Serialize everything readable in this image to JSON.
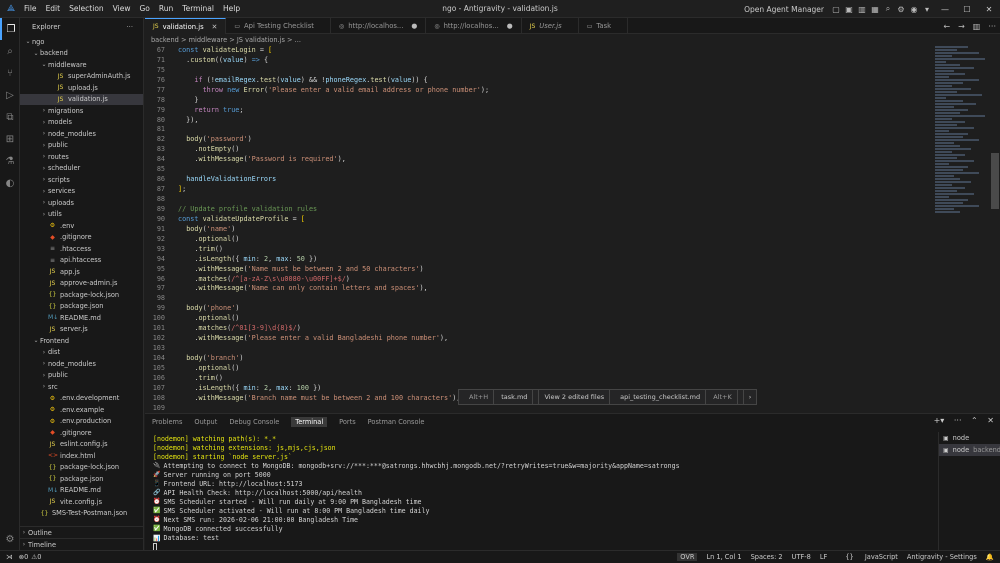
{
  "titlebar": {
    "menu": [
      "File",
      "Edit",
      "Selection",
      "View",
      "Go",
      "Run",
      "Terminal",
      "Help"
    ],
    "title": "ngo - Antigravity - validation.js",
    "agent_manager": "Open Agent Manager"
  },
  "sidebar": {
    "title": "Explorer",
    "outline": "Outline",
    "timeline": "Timeline"
  },
  "tree": [
    {
      "label": "ngo",
      "depth": 0,
      "type": "folder",
      "open": true
    },
    {
      "label": "backend",
      "depth": 1,
      "type": "folder",
      "open": true
    },
    {
      "label": "middleware",
      "depth": 2,
      "type": "folder",
      "open": true
    },
    {
      "label": "superAdminAuth.js",
      "depth": 3,
      "type": "js"
    },
    {
      "label": "upload.js",
      "depth": 3,
      "type": "js"
    },
    {
      "label": "validation.js",
      "depth": 3,
      "type": "js",
      "selected": true
    },
    {
      "label": "migrations",
      "depth": 2,
      "type": "folder"
    },
    {
      "label": "models",
      "depth": 2,
      "type": "folder"
    },
    {
      "label": "node_modules",
      "depth": 2,
      "type": "folder"
    },
    {
      "label": "public",
      "depth": 2,
      "type": "folder"
    },
    {
      "label": "routes",
      "depth": 2,
      "type": "folder"
    },
    {
      "label": "scheduler",
      "depth": 2,
      "type": "folder"
    },
    {
      "label": "scripts",
      "depth": 2,
      "type": "folder"
    },
    {
      "label": "services",
      "depth": 2,
      "type": "folder"
    },
    {
      "label": "uploads",
      "depth": 2,
      "type": "folder"
    },
    {
      "label": "utils",
      "depth": 2,
      "type": "folder"
    },
    {
      "label": ".env",
      "depth": 2,
      "type": "env"
    },
    {
      "label": ".gitignore",
      "depth": 2,
      "type": "git"
    },
    {
      "label": ".htaccess",
      "depth": 2,
      "type": "file"
    },
    {
      "label": "api.htaccess",
      "depth": 2,
      "type": "file"
    },
    {
      "label": "app.js",
      "depth": 2,
      "type": "js"
    },
    {
      "label": "approve-admin.js",
      "depth": 2,
      "type": "js"
    },
    {
      "label": "package-lock.json",
      "depth": 2,
      "type": "json"
    },
    {
      "label": "package.json",
      "depth": 2,
      "type": "json"
    },
    {
      "label": "README.md",
      "depth": 2,
      "type": "md"
    },
    {
      "label": "server.js",
      "depth": 2,
      "type": "js"
    },
    {
      "label": "Frontend",
      "depth": 1,
      "type": "folder",
      "open": true
    },
    {
      "label": "dist",
      "depth": 2,
      "type": "folder"
    },
    {
      "label": "node_modules",
      "depth": 2,
      "type": "folder"
    },
    {
      "label": "public",
      "depth": 2,
      "type": "folder"
    },
    {
      "label": "src",
      "depth": 2,
      "type": "folder"
    },
    {
      "label": ".env.development",
      "depth": 2,
      "type": "env"
    },
    {
      "label": ".env.example",
      "depth": 2,
      "type": "env"
    },
    {
      "label": ".env.production",
      "depth": 2,
      "type": "env"
    },
    {
      "label": ".gitignore",
      "depth": 2,
      "type": "git"
    },
    {
      "label": "eslint.config.js",
      "depth": 2,
      "type": "js"
    },
    {
      "label": "index.html",
      "depth": 2,
      "type": "html"
    },
    {
      "label": "package-lock.json",
      "depth": 2,
      "type": "json"
    },
    {
      "label": "package.json",
      "depth": 2,
      "type": "json"
    },
    {
      "label": "README.md",
      "depth": 2,
      "type": "md"
    },
    {
      "label": "vite.config.js",
      "depth": 2,
      "type": "js"
    },
    {
      "label": "SMS-Test-Postman.json",
      "depth": 1,
      "type": "json"
    }
  ],
  "tabs": [
    {
      "label": "validation.js",
      "active": true,
      "icon": "JS"
    },
    {
      "label": "Api Testing Checklist",
      "icon": "doc"
    },
    {
      "label": "http://localhos...",
      "icon": "globe",
      "dot": true
    },
    {
      "label": "http://localhos...",
      "icon": "globe",
      "dot": true
    },
    {
      "label": "User.js",
      "icon": "JS",
      "italic": true
    },
    {
      "label": "Task",
      "icon": "doc"
    }
  ],
  "breadcrumb": "backend > middleware > JS validation.js > ...",
  "code": [
    {
      "n": "67",
      "html": "<span class=k>const</span> <span class=f>validateLogin</span> <span class=t>=</span> <span class=b>[</span>"
    },
    {
      "n": "71",
      "html": "  .<span class=f>custom</span>((<span class=p>value</span>) <span class=k>=&gt;</span> {"
    },
    {
      "n": "75",
      "html": ""
    },
    {
      "n": "76",
      "html": "    <span class=o>if</span> (!<span class=p>emailRegex</span>.<span class=f>test</span>(<span class=p>value</span>) &amp;&amp; !<span class=p>phoneRegex</span>.<span class=f>test</span>(<span class=p>value</span>)) {"
    },
    {
      "n": "77",
      "html": "      <span class=o>throw</span> <span class=k>new</span> <span class=f>Error</span>(<span class=s>'Please enter a valid email address or phone number'</span>);"
    },
    {
      "n": "78",
      "html": "    }"
    },
    {
      "n": "79",
      "html": "    <span class=o>return</span> <span class=k>true</span>;"
    },
    {
      "n": "80",
      "html": "  }),"
    },
    {
      "n": "81",
      "html": ""
    },
    {
      "n": "82",
      "html": "  <span class=f>body</span>(<span class=s>'password'</span>)"
    },
    {
      "n": "83",
      "html": "    .<span class=f>notEmpty</span>()"
    },
    {
      "n": "84",
      "html": "    .<span class=f>withMessage</span>(<span class=s>'Password is required'</span>),"
    },
    {
      "n": "85",
      "html": ""
    },
    {
      "n": "86",
      "html": "  <span class=p>handleValidationErrors</span>"
    },
    {
      "n": "87",
      "html": "<span class=b>]</span>;"
    },
    {
      "n": "88",
      "html": ""
    },
    {
      "n": "89",
      "html": "<span class=c>// Update profile validation rules</span>"
    },
    {
      "n": "90",
      "html": "<span class=k>const</span> <span class=f>validateUpdateProfile</span> <span class=t>=</span> <span class=b>[</span>"
    },
    {
      "n": "91",
      "html": "  <span class=f>body</span>(<span class=s>'name'</span>)"
    },
    {
      "n": "92",
      "html": "    .<span class=f>optional</span>()"
    },
    {
      "n": "93",
      "html": "    .<span class=f>trim</span>()"
    },
    {
      "n": "94",
      "html": "    .<span class=f>isLength</span>({ <span class=p>min</span>: <span class=n>2</span>, <span class=p>max</span>: <span class=n>50</span> })"
    },
    {
      "n": "95",
      "html": "    .<span class=f>withMessage</span>(<span class=s>'Name must be between 2 and 50 characters'</span>)"
    },
    {
      "n": "96",
      "html": "    .<span class=f>matches</span>(<span class=r>/^[a-zA-Z\\s\\u0080-\\u00FF]+$/</span>)"
    },
    {
      "n": "97",
      "html": "    .<span class=f>withMessage</span>(<span class=s>'Name can only contain letters and spaces'</span>),"
    },
    {
      "n": "98",
      "html": ""
    },
    {
      "n": "99",
      "html": "  <span class=f>body</span>(<span class=s>'phone'</span>)"
    },
    {
      "n": "100",
      "html": "    .<span class=f>optional</span>()"
    },
    {
      "n": "101",
      "html": "    .<span class=f>matches</span>(<span class=r>/^01[3-9]\\d{8}$/</span>)"
    },
    {
      "n": "102",
      "html": "    .<span class=f>withMessage</span>(<span class=s>'Please enter a valid Bangladeshi phone number'</span>),"
    },
    {
      "n": "103",
      "html": ""
    },
    {
      "n": "104",
      "html": "  <span class=f>body</span>(<span class=s>'branch'</span>)"
    },
    {
      "n": "105",
      "html": "    .<span class=f>optional</span>()"
    },
    {
      "n": "106",
      "html": "    .<span class=f>trim</span>()"
    },
    {
      "n": "107",
      "html": "    .<span class=f>isLength</span>({ <span class=p>min</span>: <span class=n>2</span>, <span class=p>max</span>: <span class=n>100</span> })"
    },
    {
      "n": "108",
      "html": "    .<span class=f>withMessage</span>(<span class=s>'Branch name must be between 2 and 100 characters'</span>),"
    },
    {
      "n": "109",
      "html": ""
    }
  ],
  "popup": {
    "task_kb": "Alt+H",
    "task": "task.md",
    "edited": "View 2 edited files",
    "checklist": "api_testing_checklist.md",
    "checklist_kb": "Alt+K"
  },
  "panel": {
    "tabs": [
      "Problems",
      "Output",
      "Debug Console",
      "Terminal",
      "Ports",
      "Postman Console"
    ],
    "active": "Terminal"
  },
  "terminal_lines": [
    {
      "cls": "yellow",
      "text": "[nodemon] watching path(s): *.*"
    },
    {
      "cls": "yellow",
      "text": "[nodemon] watching extensions: js,mjs,cjs,json"
    },
    {
      "cls": "yellow",
      "text": "[nodemon] starting `node server.js`"
    },
    {
      "cls": "white",
      "em": "🔌",
      "text": "Attempting to connect to MongoDB: mongodb+srv://***:***@satrongs.hhwcbhj.mongodb.net/?retryWrites=true&w=majority&appName=satrongs"
    },
    {
      "cls": "white",
      "em": "🚀",
      "text": "Server running on port 5000"
    },
    {
      "cls": "white",
      "em": "📱",
      "text": "Frontend URL: http://localhost:5173"
    },
    {
      "cls": "white",
      "em": "🔗",
      "text": "API Health Check: http://localhost:5000/api/health"
    },
    {
      "cls": "white",
      "em": "⏰",
      "text": "SMS Scheduler started - Will run daily at 9:00 PM Bangladesh time"
    },
    {
      "cls": "white",
      "em": "✅",
      "text": "SMS Scheduler activated - Will run at 8:00 PM Bangladesh time daily"
    },
    {
      "cls": "white",
      "em": "⏰",
      "text": "Next SMS run: 2026-02-06 21:00:00 Bangladesh Time"
    },
    {
      "cls": "white",
      "em": "✅",
      "text": "MongoDB connected successfully"
    },
    {
      "cls": "white",
      "em": "📊",
      "text": "Database: test"
    }
  ],
  "terminal_list": [
    {
      "label": "node",
      "sub": ""
    },
    {
      "label": "node",
      "sub": "backend",
      "selected": true
    }
  ],
  "status": {
    "errors": "0",
    "warnings": "0",
    "ovr": "OVR",
    "position": "Ln 1, Col 1",
    "spaces": "Spaces: 2",
    "encoding": "UTF-8",
    "eol": "LF",
    "language": "JavaScript",
    "settings": "Antigravity - Settings"
  }
}
